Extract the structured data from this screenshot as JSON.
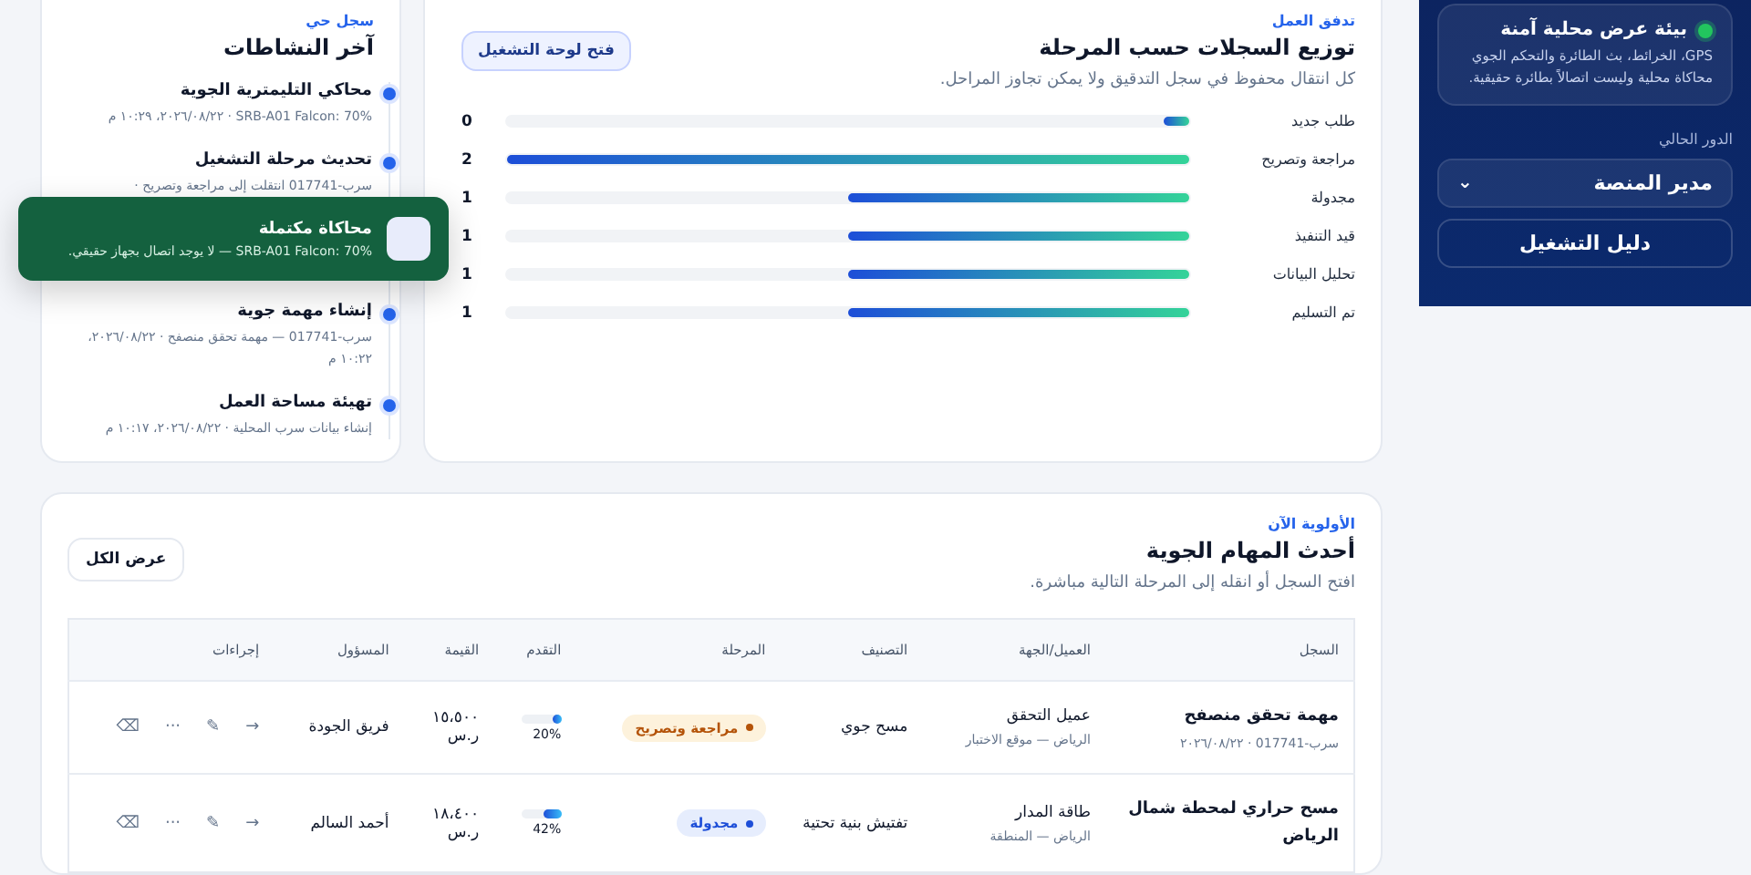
{
  "sidebar": {
    "notice": {
      "title": "بيئة عرض محلية آمنة",
      "text": "GPS، الخرائط، بث الطائرة والتحكم الجوي محاكاة محلية وليست اتصالاً بطائرة حقيقية."
    },
    "role_label": "الدور الحالي",
    "role_select": {
      "value": "مدير المنصة",
      "chevron": "⌄"
    },
    "guide_button": "دليل التشغيل"
  },
  "activity": {
    "eyebrow": "سجل حي",
    "title": "آخر النشاطات",
    "items": [
      {
        "title": "محاكي التليمترية الجوية",
        "meta": "SRB-A01 Falcon: 70% · ٢٠٢٦/٠٨/٢٢، ١٠:٢٩ م"
      },
      {
        "title": "تحديث مرحلة التشغيل",
        "meta": "سرب-017741 انتقلت إلى مراجعة وتصريح ·"
      },
      {
        "title": "إنشاء مهمة جوية",
        "meta": "سرب-017741 — مهمة تحقق منصفح · ٢٠٢٦/٠٨/٢٢، ١٠:٢٢ م"
      },
      {
        "title": "تهيئة مساحة العمل",
        "meta": "إنشاء بيانات سرب المحلية · ٢٠٢٦/٠٨/٢٢، ١٠:١٧ م"
      }
    ]
  },
  "distribution": {
    "eyebrow": "تدفق العمل",
    "title": "توزيع السجلات حسب المرحلة",
    "subtitle": "كل انتقال محفوظ في سجل التدقيق ولا يمكن تجاوز المراحل.",
    "button": "فتح لوحة التشغيل",
    "stages": [
      {
        "label": "طلب جديد",
        "count": "0",
        "level": 0.02
      },
      {
        "label": "مراجعة وتصريح",
        "count": "2",
        "level": 1
      },
      {
        "label": "مجدولة",
        "count": "1",
        "level": 0.5
      },
      {
        "label": "قيد التنفيذ",
        "count": "1",
        "level": 0.5
      },
      {
        "label": "تحليل البيانات",
        "count": "1",
        "level": 0.5
      },
      {
        "label": "تم التسليم",
        "count": "1",
        "level": 0.5
      }
    ]
  },
  "toast": {
    "title": "محاكاة مكتملة",
    "text": "SRB-A01 Falcon: 70% — لا يوجد اتصال بجهاز حقيقي."
  },
  "missions": {
    "eyebrow": "الأولوية الآن",
    "title": "أحدث المهام الجوية",
    "subtitle": "افتح السجل أو انقله إلى المرحلة التالية مباشرة.",
    "view_all": "عرض الكل",
    "columns": [
      "السجل",
      "العميل/الجهة",
      "التصنيف",
      "المرحلة",
      "التقدم",
      "القيمة",
      "المسؤول",
      "إجراءات"
    ],
    "rows": [
      {
        "title": "مهمة تحقق منصفح",
        "ref": "سرب-017741 · ٢٠٢٦/٠٨/٢٢",
        "client": "عميل التحقق",
        "location": "الرياض — موقع الاختبار",
        "category": "مسح جوي",
        "stage": {
          "label": "مراجعة وتصريح",
          "kind": "review"
        },
        "level": 0.2,
        "progress": "20%",
        "value": "١٥،٥٠٠",
        "currency": "ر.س",
        "owner": "فريق الجودة",
        "actions": [
          "→",
          "✎",
          "···",
          "⌫"
        ]
      },
      {
        "title": "مسح حراري لمحطة شمال الرياض",
        "client": "طاقة المدار",
        "location": "الرياض — المنطقة",
        "category": "تفتيش بنية تحتية",
        "stage": {
          "label": "مجدولة",
          "kind": "scheduled"
        },
        "level": 0.42,
        "progress": "42%",
        "value": "١٨،٤٠٠",
        "currency": "ر.س",
        "owner": "أحمد السالم",
        "actions": [
          "→",
          "✎",
          "···",
          "⌫"
        ]
      }
    ]
  }
}
